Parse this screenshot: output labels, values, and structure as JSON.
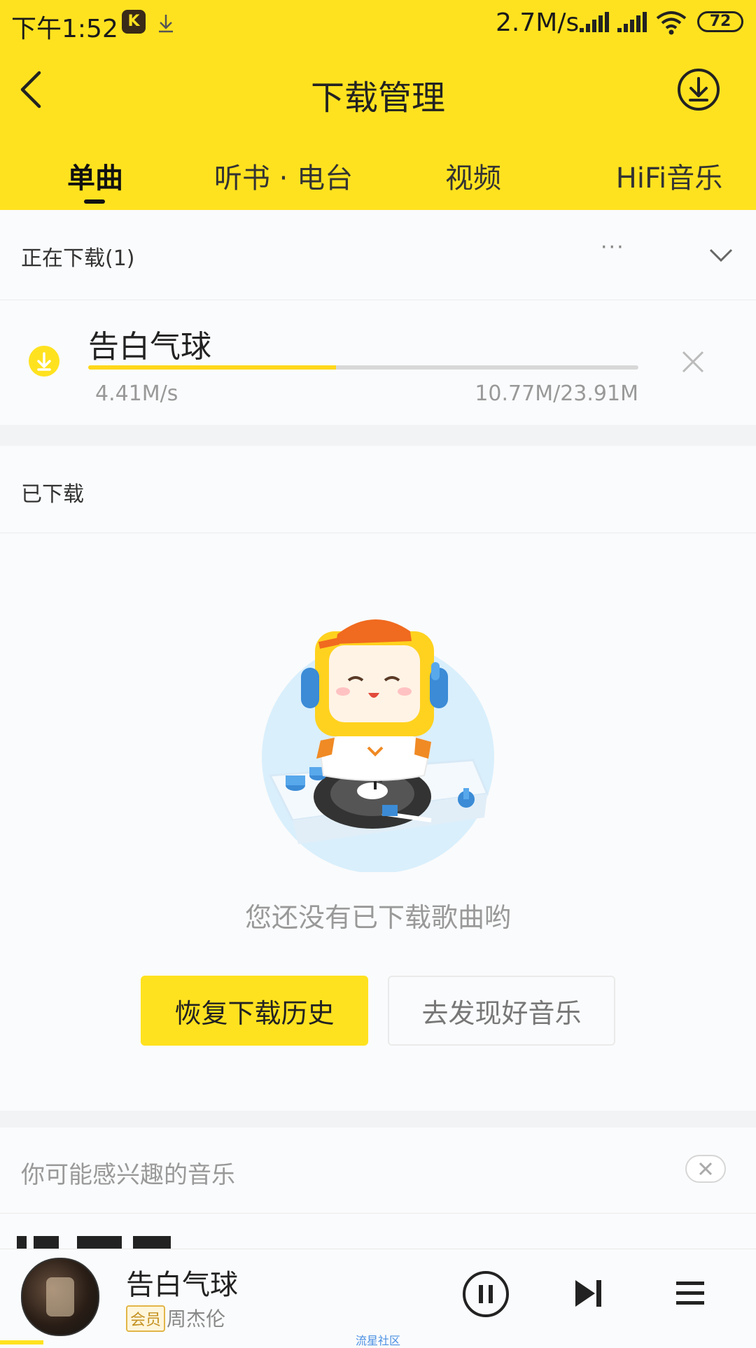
{
  "status_bar": {
    "time": "下午1:52",
    "speed": "2.7M/s",
    "battery": "72"
  },
  "header": {
    "title": "下载管理"
  },
  "tabs": [
    {
      "label": "单曲",
      "active": true
    },
    {
      "label": "听书 · 电台",
      "active": false
    },
    {
      "label": "视频",
      "active": false
    },
    {
      "label": "HiFi音乐",
      "active": false
    }
  ],
  "downloading": {
    "header_label": "正在下载(1)",
    "more_label": "···",
    "item": {
      "title": "告白气球",
      "speed": "4.41M/s",
      "size": "10.77M/23.91M",
      "progress": 0.45
    }
  },
  "downloaded": {
    "header_label": "已下载",
    "empty_text": "您还没有已下载歌曲哟",
    "restore_button": "恢复下载历史",
    "discover_button": "去发现好音乐"
  },
  "recommend": {
    "header_label": "你可能感兴趣的音乐"
  },
  "mini_player": {
    "title": "告白气球",
    "badge": "会员",
    "artist": "周杰伦",
    "watermark": "流星社区"
  },
  "colors": {
    "brand_yellow": "#ffe21f",
    "progress_fill": "#ffd71a"
  }
}
